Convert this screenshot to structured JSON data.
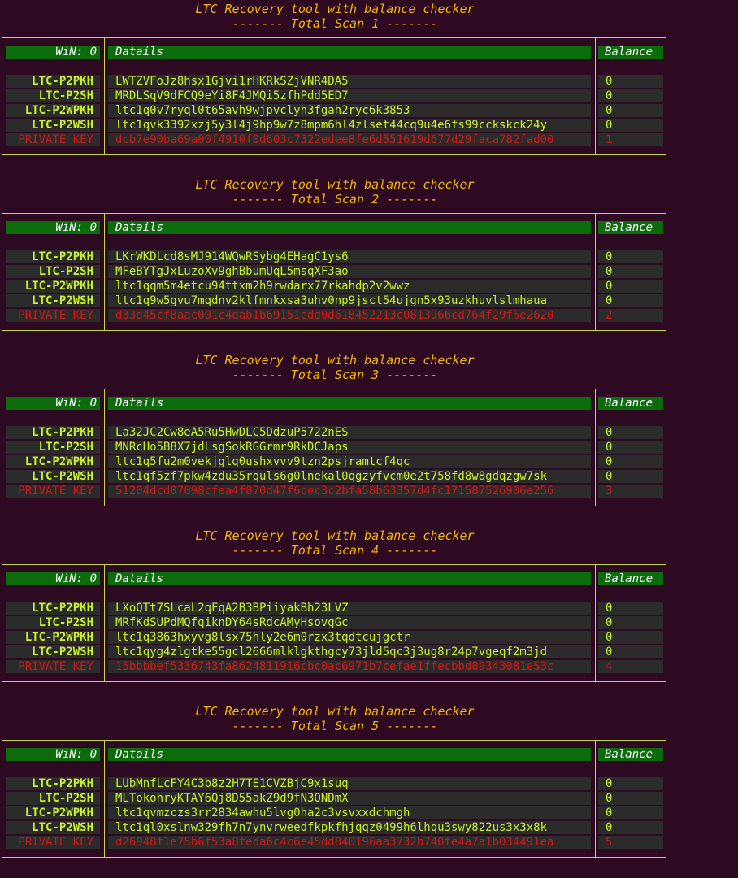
{
  "scans": [
    {
      "title": "LTC Recovery tool with balance checker",
      "subtitle": "------- Total Scan 1 -------",
      "win_label": "WiN: 0",
      "details_label": "Datails",
      "balance_label": "Balance",
      "rows": [
        {
          "label": "LTC-P2PKH",
          "value": "LWTZVFoJz8hsx1Gjvi1rHKRkSZjVNR4DA5",
          "balance": "0"
        },
        {
          "label": "LTC-P2SH",
          "value": "MRDLSqV9dFCQ9eYi8F4JMQi5zfhPdd5ED7",
          "balance": "0"
        },
        {
          "label": "LTC-P2WPKH",
          "value": "ltc1q0v7ryql0t65avh9wjpvclyh3fgah2ryc6k3853",
          "balance": "0"
        },
        {
          "label": "LTC-P2WSH",
          "value": "ltc1qvk3392xzj5y3l4j9hp9w7z8mpm6hl4zlset44cq9u4e6fs99cckskck24y",
          "balance": "0"
        },
        {
          "label": "PRIVATE KEY",
          "value": "dcb7e90ba69a00f4910f0d603c7322edee8fe6d551619d677d29faca782fad00",
          "balance": "1"
        }
      ]
    },
    {
      "title": "LTC Recovery tool with balance checker",
      "subtitle": "------- Total Scan 2 -------",
      "win_label": "WiN: 0",
      "details_label": "Datails",
      "balance_label": "Balance",
      "rows": [
        {
          "label": "LTC-P2PKH",
          "value": "LKrWKDLcd8sMJ914WQwRSybg4EHagC1ys6",
          "balance": "0"
        },
        {
          "label": "LTC-P2SH",
          "value": "MFeBYTgJxLuzoXv9ghBbumUqL5msqXF3ao",
          "balance": "0"
        },
        {
          "label": "LTC-P2WPKH",
          "value": "ltc1qqm5m4etcu94ttxm2h9rwdarx77rkahdp2v2wwz",
          "balance": "0"
        },
        {
          "label": "LTC-P2WSH",
          "value": "ltc1q9w5gvu7mqdnv2klfmnkxsa3uhv0np9jsct54ujgn5x93uzkhuvlslmhaua",
          "balance": "0"
        },
        {
          "label": "PRIVATE KEY",
          "value": "d33d45cf8aac001c4dab1b69151edd0d618452213c0813966cd764f29f5e2620",
          "balance": "2"
        }
      ]
    },
    {
      "title": "LTC Recovery tool with balance checker",
      "subtitle": "------- Total Scan 3 -------",
      "win_label": "WiN: 0",
      "details_label": "Datails",
      "balance_label": "Balance",
      "rows": [
        {
          "label": "LTC-P2PKH",
          "value": "La32JC2Cw8eA5Ru5HwDLC5DdzuP5722nES",
          "balance": "0"
        },
        {
          "label": "LTC-P2SH",
          "value": "MNRcHo5B8X7jdLsgSokRGGrmr9RkDCJaps",
          "balance": "0"
        },
        {
          "label": "LTC-P2WPKH",
          "value": "ltc1q5fu2m0vekjglq0ushxvvv9tzn2psjramtcf4qc",
          "balance": "0"
        },
        {
          "label": "LTC-P2WSH",
          "value": "ltc1qf5zf7pkw4zdu35rquls6g0lnekal0qgzyfvcm0e2t758fd8w8gdqzgw7sk",
          "balance": "0"
        },
        {
          "label": "PRIVATE KEY",
          "value": "51204dcd07098cfea4f870d47f6cec3c2bfa58b63357d4fc171587526906e256",
          "balance": "3"
        }
      ]
    },
    {
      "title": "LTC Recovery tool with balance checker",
      "subtitle": "------- Total Scan 4 -------",
      "win_label": "WiN: 0",
      "details_label": "Datails",
      "balance_label": "Balance",
      "rows": [
        {
          "label": "LTC-P2PKH",
          "value": "LXoQTt7SLcaL2qFqA2B3BPiiyakBh23LVZ",
          "balance": "0"
        },
        {
          "label": "LTC-P2SH",
          "value": "MRfKdSUPdMQfqiknDY64sRdcAMyHsovgGc",
          "balance": "0"
        },
        {
          "label": "LTC-P2WPKH",
          "value": "ltc1q3863hxyvg8lsx75hly2e6m0rzx3tqdtcujgctr",
          "balance": "0"
        },
        {
          "label": "LTC-P2WSH",
          "value": "ltc1qyg4zlgtke55gcl2666mlklgkthgcy73jld5qc3j3ug8r24p7vgeqf2m3jd",
          "balance": "0"
        },
        {
          "label": "PRIVATE KEY",
          "value": "15bbbbef5336743fa8624811916cbc0ac6971b7cefae1ffecbbd89343081e53c",
          "balance": "4"
        }
      ]
    },
    {
      "title": "LTC Recovery tool with balance checker",
      "subtitle": "------- Total Scan 5 -------",
      "win_label": "WiN: 0",
      "details_label": "Datails",
      "balance_label": "Balance",
      "rows": [
        {
          "label": "LTC-P2PKH",
          "value": "LUbMnfLcFY4C3b8z2H7TE1CVZBjC9x1suq",
          "balance": "0"
        },
        {
          "label": "LTC-P2SH",
          "value": "MLTokohryKTAY6Qj8D55akZ9d9fN3QNDmX",
          "balance": "0"
        },
        {
          "label": "LTC-P2WPKH",
          "value": "ltc1qvmzczs3rr2834awhu5lvg0ha2c3vsvxxdchmgh",
          "balance": "0"
        },
        {
          "label": "LTC-P2WSH",
          "value": "ltc1ql0xslnw329fh7n7ynvrweedfkpkfhjqqz0499h6lhqu3swy822us3x3x8k",
          "balance": "0"
        },
        {
          "label": "PRIVATE KEY",
          "value": "d26948f1e75b6f53a8feda6c4c6e45dd840196aa3732b740fe4a7a1b034491ea",
          "balance": "5"
        }
      ]
    }
  ]
}
